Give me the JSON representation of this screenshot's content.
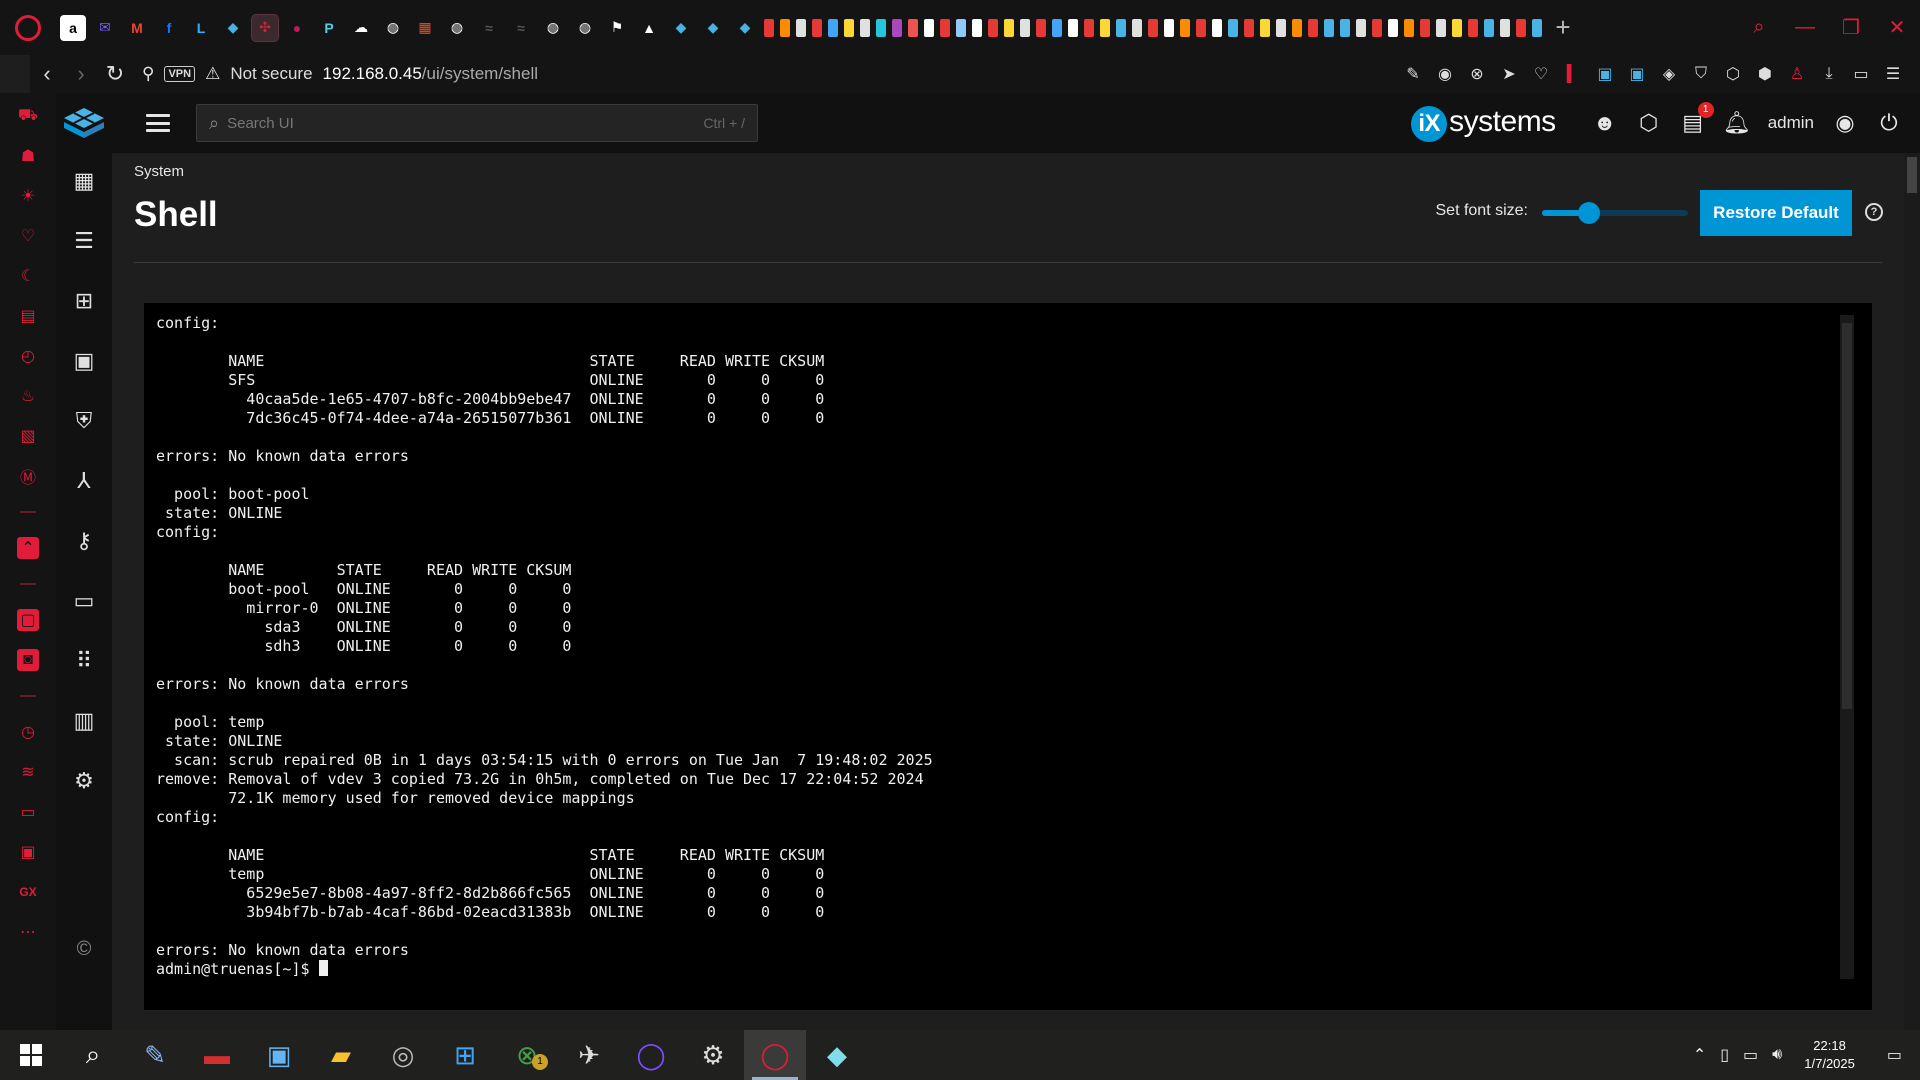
{
  "browser": {
    "tabs_icons": [
      "amazon",
      "mail",
      "gmail",
      "facebook",
      "linkedin",
      "truenas",
      "active-tab",
      "raspberry",
      "tp-link",
      "cloud",
      "globe",
      "microsoft",
      "globe",
      "tab",
      "tab",
      "globe",
      "globe",
      "flag",
      "triangle",
      "truenas",
      "truenas",
      "truenas"
    ],
    "url_host": "192.168.0.45",
    "url_path": "/ui/system/shell",
    "security_label": "Not secure",
    "vpn_label": "VPN"
  },
  "app": {
    "search_placeholder": "Search UI",
    "search_shortcut": "Ctrl + /",
    "brand": "systems",
    "brand_mark": "iX",
    "user": "admin",
    "jobs_badge": "1"
  },
  "page": {
    "breadcrumb": "System",
    "title": "Shell",
    "font_size_label": "Set font size:",
    "font_size_value": 0.32,
    "restore_label": "Restore Default",
    "help_glyph": "?"
  },
  "terminal": {
    "lines": [
      "config:",
      "",
      "        NAME                                    STATE     READ WRITE CKSUM",
      "        SFS                                     ONLINE       0     0     0",
      "          40caa5de-1e65-4707-b8fc-2004bb9ebe47  ONLINE       0     0     0",
      "          7dc36c45-0f74-4dee-a74a-26515077b361  ONLINE       0     0     0",
      "",
      "errors: No known data errors",
      "",
      "  pool: boot-pool",
      " state: ONLINE",
      "config:",
      "",
      "        NAME        STATE     READ WRITE CKSUM",
      "        boot-pool   ONLINE       0     0     0",
      "          mirror-0  ONLINE       0     0     0",
      "            sda3    ONLINE       0     0     0",
      "            sdh3    ONLINE       0     0     0",
      "",
      "errors: No known data errors",
      "",
      "  pool: temp",
      " state: ONLINE",
      "  scan: scrub repaired 0B in 1 days 03:54:15 with 0 errors on Tue Jan  7 19:48:02 2025",
      "remove: Removal of vdev 3 copied 73.2G in 0h5m, completed on Tue Dec 17 22:04:52 2024",
      "        72.1K memory used for removed device mappings",
      "config:",
      "",
      "        NAME                                    STATE     READ WRITE CKSUM",
      "        temp                                    ONLINE       0     0     0",
      "          6529e5e7-8b08-4a97-8ff2-8d2b866fc565  ONLINE       0     0     0",
      "          3b94bf7b-b7ab-4caf-86bd-02eacd31383b  ONLINE       0     0     0",
      "",
      "errors: No known data errors"
    ],
    "prompt": "admin@truenas[~]$ "
  },
  "taskbar": {
    "time": "22:18",
    "date": "1/7/2025",
    "xbox_badge": "1"
  },
  "colors": {
    "accent": "#0095d5",
    "opera_red": "#e01c3a",
    "terminal_bg": "#000000"
  }
}
